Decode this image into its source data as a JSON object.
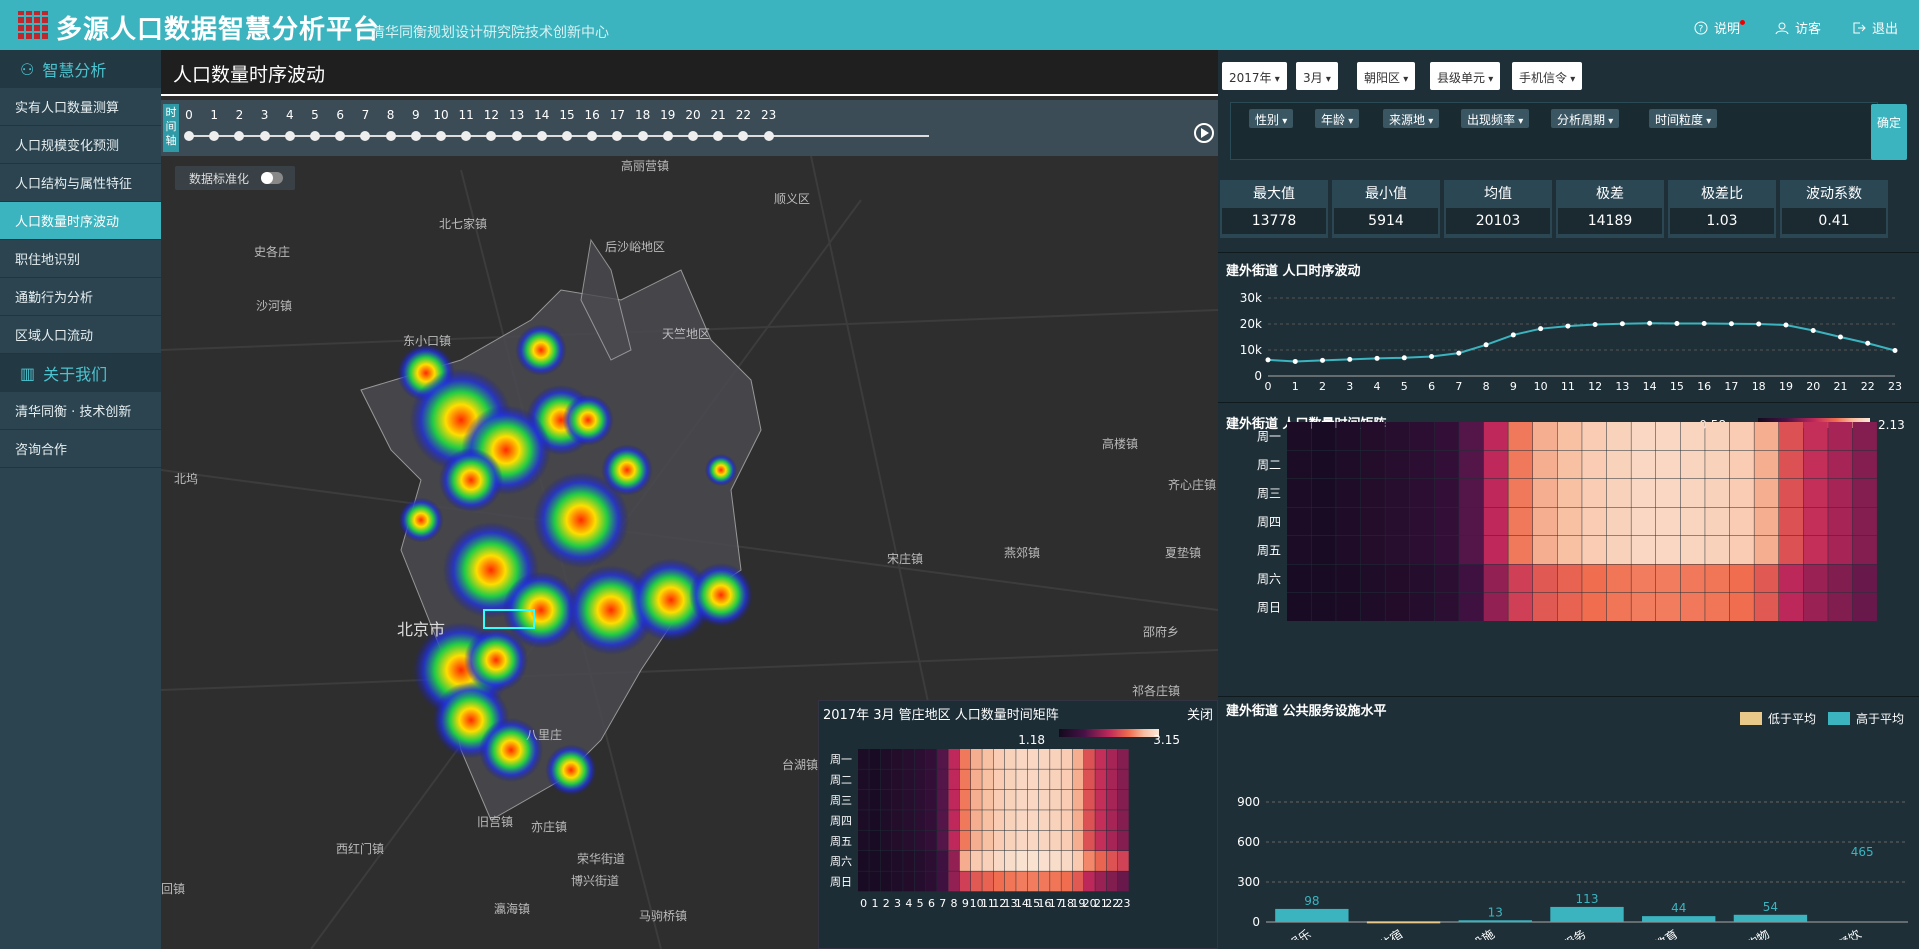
{
  "header": {
    "title": "多源人口数据智慧分析平台",
    "subtitle": "清华同衡规划设计研究院技术创新中心",
    "help": "说明",
    "visitor": "访客",
    "logout": "退出"
  },
  "sidebar": {
    "section1": "智慧分析",
    "items": [
      "实有人口数量测算",
      "人口规模变化预测",
      "人口结构与属性特征",
      "人口数量时序波动",
      "职住地识别",
      "通勤行为分析",
      "区域人口流动"
    ],
    "active": 3,
    "section2": "关于我们",
    "items2": [
      "清华同衡 · 技术创新",
      "咨询合作"
    ]
  },
  "map": {
    "panel_title": "人口数量时序波动",
    "timeline_label": "时间轴",
    "hours": [
      "0",
      "1",
      "2",
      "3",
      "4",
      "5",
      "6",
      "7",
      "8",
      "9",
      "10",
      "11",
      "12",
      "13",
      "14",
      "15",
      "16",
      "17",
      "18",
      "19",
      "20",
      "21",
      "22",
      "23"
    ],
    "normalize_label": "数据标准化",
    "places": [
      {
        "t": "北七家镇",
        "c": "normal"
      },
      {
        "t": "顺义区",
        "c": "normal"
      },
      {
        "t": "后沙峪地区",
        "c": "normal"
      },
      {
        "t": "天竺地区",
        "c": "normal"
      },
      {
        "t": "东小口镇",
        "c": "normal"
      },
      {
        "t": "北京市",
        "c": "big"
      },
      {
        "t": "宋庄镇",
        "c": "normal"
      },
      {
        "t": "燕郊镇",
        "c": "normal"
      },
      {
        "t": "夏垫镇",
        "c": "normal"
      },
      {
        "t": "邵府乡",
        "c": "normal"
      },
      {
        "t": "高楼镇",
        "c": "normal"
      },
      {
        "t": "台湖镇",
        "c": "normal"
      },
      {
        "t": "旧宫镇",
        "c": "normal"
      },
      {
        "t": "亦庄镇",
        "c": "normal"
      },
      {
        "t": "西红门镇",
        "c": "normal"
      },
      {
        "t": "荣华街道",
        "c": "normal"
      },
      {
        "t": "博兴街道",
        "c": "normal"
      },
      {
        "t": "瀛海镇",
        "c": "normal"
      },
      {
        "t": "马驹桥镇",
        "c": "normal"
      },
      {
        "t": "高丽营镇",
        "c": "normal"
      },
      {
        "t": "齐心庄镇",
        "c": "normal"
      },
      {
        "t": "祁各庄镇",
        "c": "normal"
      },
      {
        "t": "史各庄",
        "c": "normal"
      },
      {
        "t": "沙河镇",
        "c": "normal"
      },
      {
        "t": "北坞",
        "c": "normal"
      },
      {
        "t": "回镇",
        "c": "normal"
      },
      {
        "t": "八里庄",
        "c": "normal"
      }
    ]
  },
  "popup": {
    "title": "2017年 3月 管庄地区 人口数量时间矩阵",
    "close": "关闭",
    "scale_min": "1.18",
    "scale_max": "3.15",
    "days": [
      "周一",
      "周二",
      "周三",
      "周四",
      "周五",
      "周六",
      "周日"
    ]
  },
  "filters": {
    "year": "2017年",
    "month": "3月",
    "district": "朝阳区",
    "unit": "县级单元",
    "source": "手机信令",
    "tags": [
      "性别",
      "年龄",
      "来源地",
      "出现频率",
      "分析周期",
      "时间粒度"
    ],
    "confirm": "确定"
  },
  "stats": [
    {
      "label": "最大值",
      "value": "13778"
    },
    {
      "label": "最小值",
      "value": "5914"
    },
    {
      "label": "均值",
      "value": "20103"
    },
    {
      "label": "极差",
      "value": "14189"
    },
    {
      "label": "极差比",
      "value": "1.03"
    },
    {
      "label": "波动系数",
      "value": "0.41"
    }
  ],
  "chart_data": [
    {
      "type": "line",
      "title": "建外街道 人口时序波动",
      "x": [
        0,
        1,
        2,
        3,
        4,
        5,
        6,
        7,
        8,
        9,
        10,
        11,
        12,
        13,
        14,
        15,
        16,
        17,
        18,
        19,
        20,
        21,
        22,
        23
      ],
      "values": [
        6200,
        5600,
        6000,
        6400,
        6800,
        7000,
        7500,
        8800,
        12000,
        15800,
        18200,
        19200,
        19800,
        20100,
        20300,
        20200,
        20200,
        20100,
        20000,
        19600,
        17500,
        15000,
        12600,
        9800
      ],
      "yticks": [
        "0",
        "10k",
        "20k",
        "30k"
      ],
      "ylim": [
        0,
        30000
      ]
    },
    {
      "type": "heatmap",
      "title": "建外街道 人口数量时间矩阵",
      "rows": [
        "周一",
        "周二",
        "周三",
        "周四",
        "周五",
        "周六",
        "周日"
      ],
      "cols": [
        "0",
        "1",
        "2",
        "3",
        "4",
        "5",
        "6",
        "7",
        "8",
        "9",
        "10",
        "11",
        "12",
        "13",
        "14",
        "15",
        "16",
        "17",
        "18",
        "19",
        "20",
        "21",
        "22",
        "23"
      ],
      "scale_min": "0.58",
      "scale_max": "2.13"
    },
    {
      "type": "bar",
      "title": "建外街道 公共服务设施水平",
      "legend": [
        "低于平均",
        "高于平均"
      ],
      "categories": [
        "休闲娱乐",
        "住宿",
        "公共设施",
        "生活服务",
        "科研教育",
        "购物",
        "餐饮"
      ],
      "values": [
        98,
        5,
        13,
        113,
        44,
        54,
        465
      ],
      "labels": [
        "98",
        "",
        "13",
        "113",
        "44",
        "54",
        "465"
      ],
      "yticks": [
        "0",
        "300",
        "600",
        "900"
      ],
      "ylim": [
        0,
        900
      ]
    }
  ],
  "colors": {
    "accent": "#3bb4bf",
    "sidebar": "#2b4450",
    "below": "#e8c98a",
    "above": "#3bb4bf"
  }
}
